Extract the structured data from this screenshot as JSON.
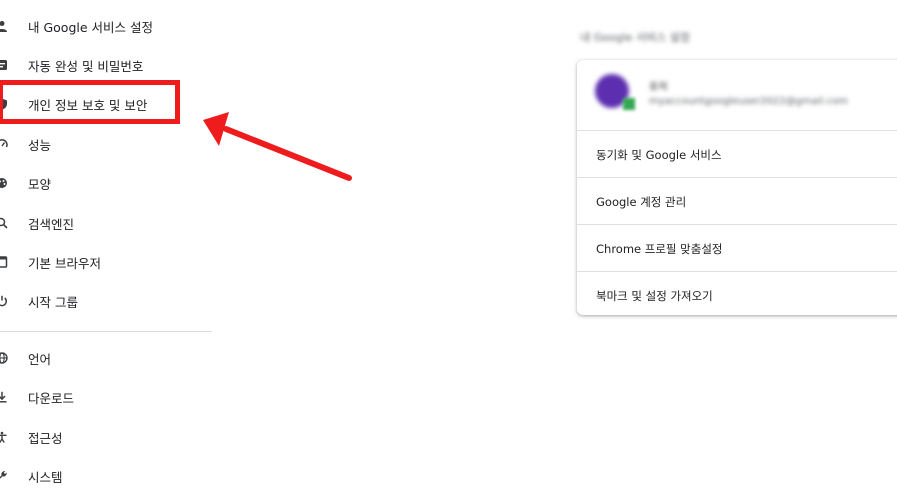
{
  "sidebar": {
    "items": [
      {
        "label": "내 Google 서비스 설정",
        "icon": "person-icon"
      },
      {
        "label": "자동 완성 및 비밀번호",
        "icon": "autofill-icon"
      },
      {
        "label": "개인 정보 보호 및 보안",
        "icon": "shield-icon"
      },
      {
        "label": "성능",
        "icon": "speedometer-icon"
      },
      {
        "label": "모양",
        "icon": "palette-icon"
      },
      {
        "label": "검색엔진",
        "icon": "search-icon"
      },
      {
        "label": "기본 브라우저",
        "icon": "browser-icon"
      },
      {
        "label": "시작 그룹",
        "icon": "power-icon"
      },
      {
        "label": "언어",
        "icon": "globe-icon"
      },
      {
        "label": "다운로드",
        "icon": "download-icon"
      },
      {
        "label": "접근성",
        "icon": "accessibility-icon"
      },
      {
        "label": "시스템",
        "icon": "wrench-icon"
      }
    ],
    "highlighted_index": 2
  },
  "annotation": {
    "highlight_color": "#ee1c1c",
    "arrow_color": "#ee1c1c"
  },
  "main": {
    "section_heading": "내 Google 서비스 설정",
    "profile": {
      "name": "유저",
      "email": "myaccountgoogleuser2022@gmail.com",
      "avatar_color": "#5d2fb0",
      "badge_color": "#34a853"
    },
    "menu_rows": [
      {
        "label": "동기화 및 Google 서비스"
      },
      {
        "label": "Google 계정 관리"
      },
      {
        "label": "Chrome 프로필 맞춤설정"
      },
      {
        "label": "북마크 및 설정 가져오기"
      }
    ]
  }
}
